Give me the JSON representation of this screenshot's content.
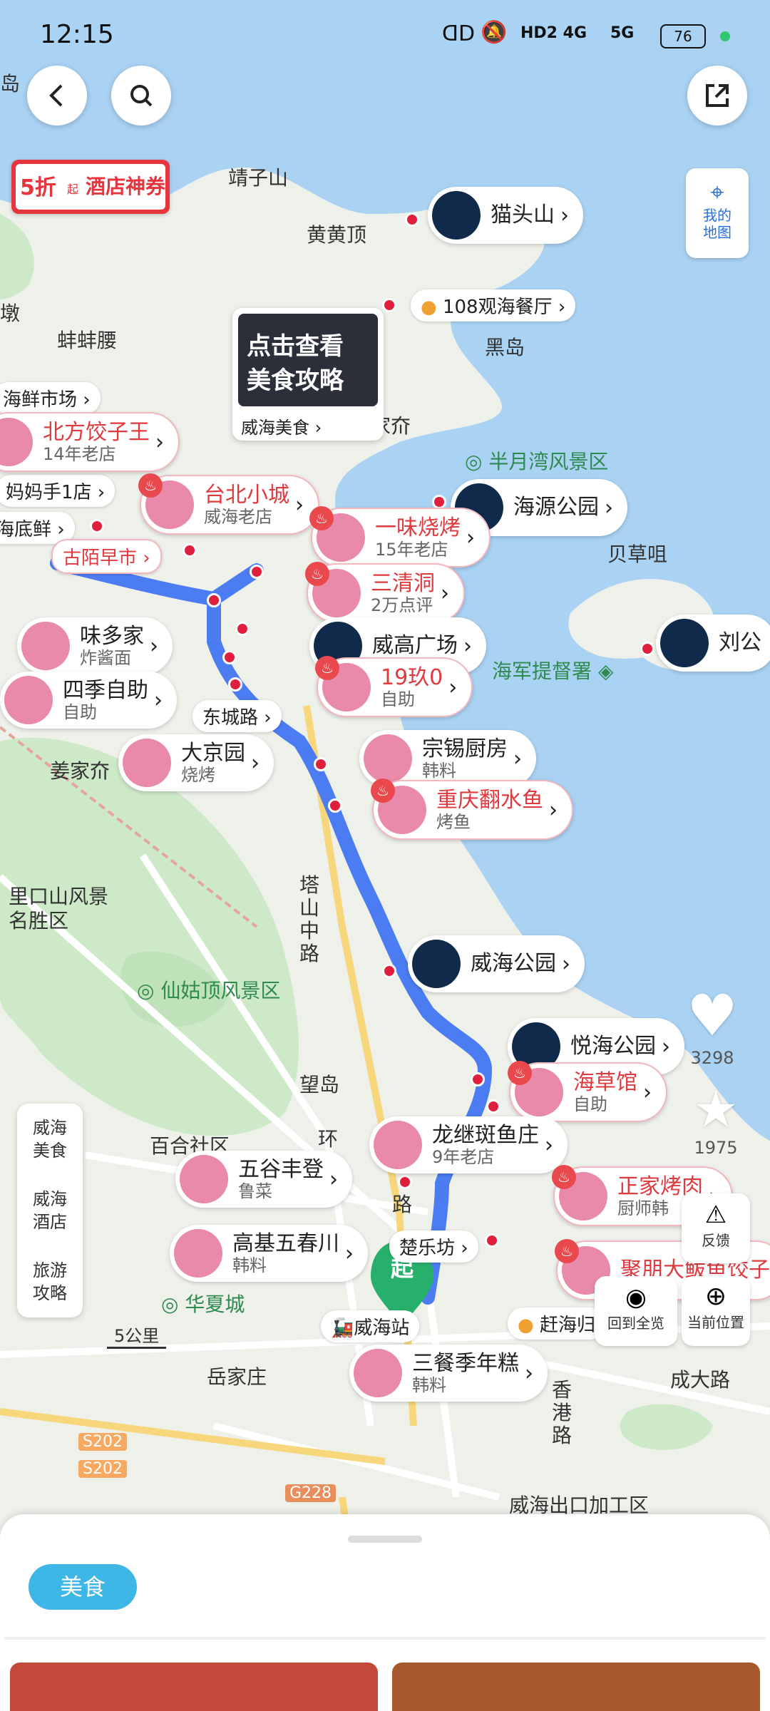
{
  "status_bar": {
    "time": "12:15",
    "network1": "HD2 4G",
    "network2": "5G",
    "battery": "76"
  },
  "top_bar": {
    "back": "back-icon",
    "search": "search-icon",
    "share": "share-icon"
  },
  "promo": {
    "discount": "5折",
    "qi": "起",
    "text": "酒店神券"
  },
  "my_map": {
    "line1": "我的",
    "line2": "地图"
  },
  "food_guide": {
    "line1": "点击查看",
    "line2": "美食攻略",
    "caption": "威海美食"
  },
  "map_labels": {
    "jingzishan": "靖子山",
    "huanghuangding": "黄黄顶",
    "bangbangyao": "蚌蚌腰",
    "heidao": "黑岛",
    "banyuewan": "半月湾风景区",
    "beicaodui": "贝草咀",
    "haijun": "海军提督署",
    "jiangjiaji": "姜家夼",
    "likoushan1": "里口山风景",
    "likoushan2": "名胜区",
    "xianguding": "仙姑顶风景区",
    "tashan": "塔山中路",
    "wangdao": "望岛",
    "baihe": "百合社区",
    "huanxia": "华夏城",
    "yuejiazhuang": "岳家庄",
    "chengda": "成大路",
    "chukou": "威海出口加工区",
    "xiang": "香港路",
    "s202a": "S202",
    "s202b": "S202",
    "g228": "G228",
    "scale": "5公里",
    "dun": "墩",
    "dao": "岛",
    "jia": "家夼",
    "huan": "环",
    "lu": "路"
  },
  "pois": [
    {
      "name": "猫头山",
      "sub": ""
    },
    {
      "name": "108观海餐厅",
      "sub": ""
    },
    {
      "name": "北方饺子王",
      "sub": "14年老店"
    },
    {
      "name": "台北小城",
      "sub": "威海老店"
    },
    {
      "name": "海源公园",
      "sub": ""
    },
    {
      "name": "一味烧烤",
      "sub": "15年老店"
    },
    {
      "name": "三清洞",
      "sub": "2万点评"
    },
    {
      "name": "味多家",
      "sub": "炸酱面"
    },
    {
      "name": "威高广场",
      "sub": ""
    },
    {
      "name": "刘公",
      "sub": ""
    },
    {
      "name": "四季自助",
      "sub": "自助"
    },
    {
      "name": "19玖0",
      "sub": "自助"
    },
    {
      "name": "大京园",
      "sub": "烧烤"
    },
    {
      "name": "宗锡厨房",
      "sub": "韩料"
    },
    {
      "name": "重庆翻水鱼",
      "sub": "烤鱼"
    },
    {
      "name": "威海公园",
      "sub": ""
    },
    {
      "name": "悦海公园",
      "sub": ""
    },
    {
      "name": "海草馆",
      "sub": "自助"
    },
    {
      "name": "龙继斑鱼庄",
      "sub": "9年老店"
    },
    {
      "name": "五谷丰登",
      "sub": "鲁菜"
    },
    {
      "name": "正家烤肉",
      "sub": "厨师韩"
    },
    {
      "name": "高基五春川",
      "sub": "韩料"
    },
    {
      "name": "聚朋大鲅鱼饺子",
      "sub": ""
    },
    {
      "name": "三餐季年糕",
      "sub": "韩料"
    }
  ],
  "tags": {
    "haixian": "海鲜市场",
    "mama": "妈妈手1店",
    "dixian": "海底鲜",
    "gumo": "古陌早市",
    "dongcheng": "东城路",
    "zhile": "楚乐坊",
    "station": "威海站",
    "ganhai": "赶海归"
  },
  "side_panel": {
    "food1": "威海",
    "food2": "美食",
    "hotel1": "威海",
    "hotel2": "酒店",
    "guide1": "旅游",
    "guide2": "攻略"
  },
  "right_controls": {
    "likes": "3298",
    "stars": "1975",
    "feedback": "反馈",
    "overview": "回到全览",
    "location": "当前位置"
  },
  "start_marker": "起",
  "bottom": {
    "tab": "美食"
  }
}
